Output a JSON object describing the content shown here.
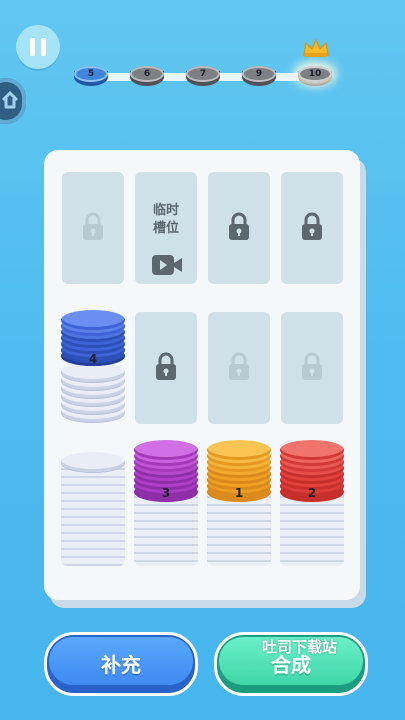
{
  "logo_text": "",
  "progress": {
    "levels": [
      "5",
      "6",
      "7",
      "9",
      "10"
    ],
    "current_index": 0
  },
  "temp_slot": {
    "line1": "临时",
    "line2": "槽位"
  },
  "stacks": [
    {
      "label": "4",
      "color": "#3e63d6"
    },
    {
      "label": "3",
      "color": "#b03fc8"
    },
    {
      "label": "1",
      "color": "#f0a125"
    },
    {
      "label": "2",
      "color": "#e2413c"
    }
  ],
  "buttons": {
    "refill": "补充",
    "merge": "合成"
  },
  "watermark": "吐司下载站",
  "colors": {
    "background": "#52bfef",
    "board": "#f4f8fb",
    "refill": "#3f8af0",
    "merge": "#3fd6a8"
  },
  "icons": {
    "pause": "pause-icon",
    "lock": "lock-icon",
    "video": "video-icon",
    "crown": "crown-icon",
    "side": "home-icon"
  }
}
